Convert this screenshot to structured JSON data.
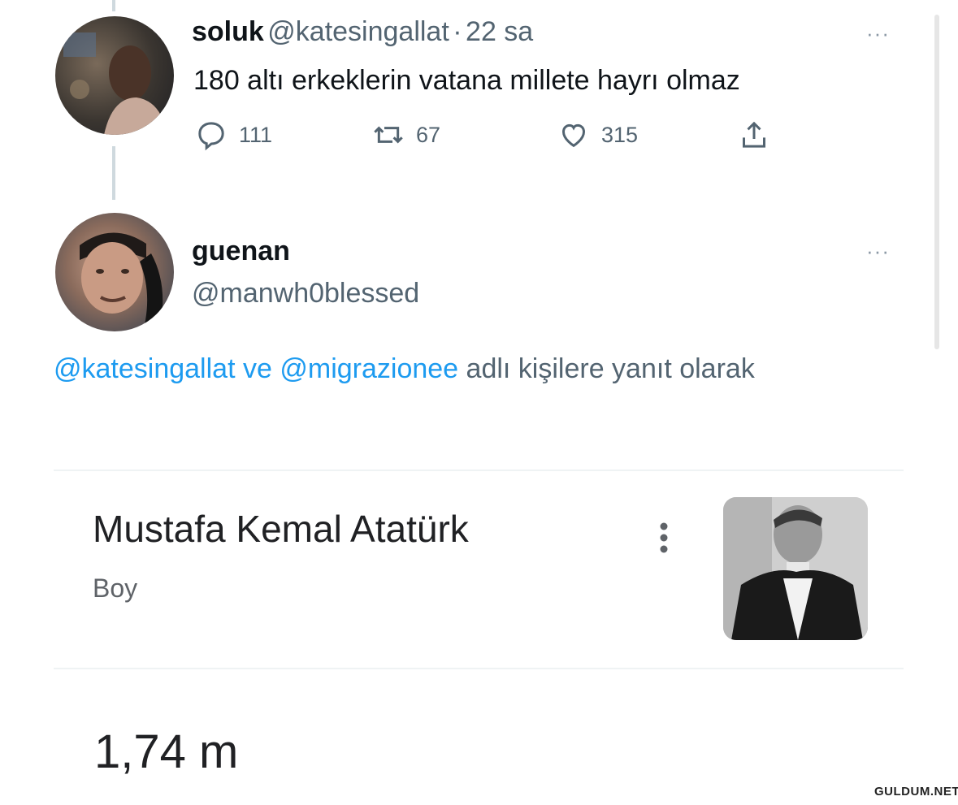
{
  "tweet1": {
    "name": "soluk",
    "handle": "@katesingallat",
    "sep": "·",
    "time": "22 sa",
    "more": "···",
    "text": "180 altı erkeklerin vatana millete hayrı olmaz",
    "actions": {
      "reply": "111",
      "retweet": "67",
      "like": "315"
    }
  },
  "reply": {
    "name": "guenan",
    "handle": "@manwh0blessed",
    "more": "···",
    "reply_prefix_1": "@katesingallat",
    "reply_and": "ve",
    "reply_prefix_2": "@migrazionee",
    "reply_suffix": "adlı kişilere yanıt olarak"
  },
  "card": {
    "title": "Mustafa Kemal Atatürk",
    "subtitle": "Boy",
    "value": "1,74 m"
  },
  "watermark": "GULDUM.NET",
  "colors": {
    "link": "#1d9bf0",
    "muted": "#536471",
    "text": "#0f1419"
  }
}
